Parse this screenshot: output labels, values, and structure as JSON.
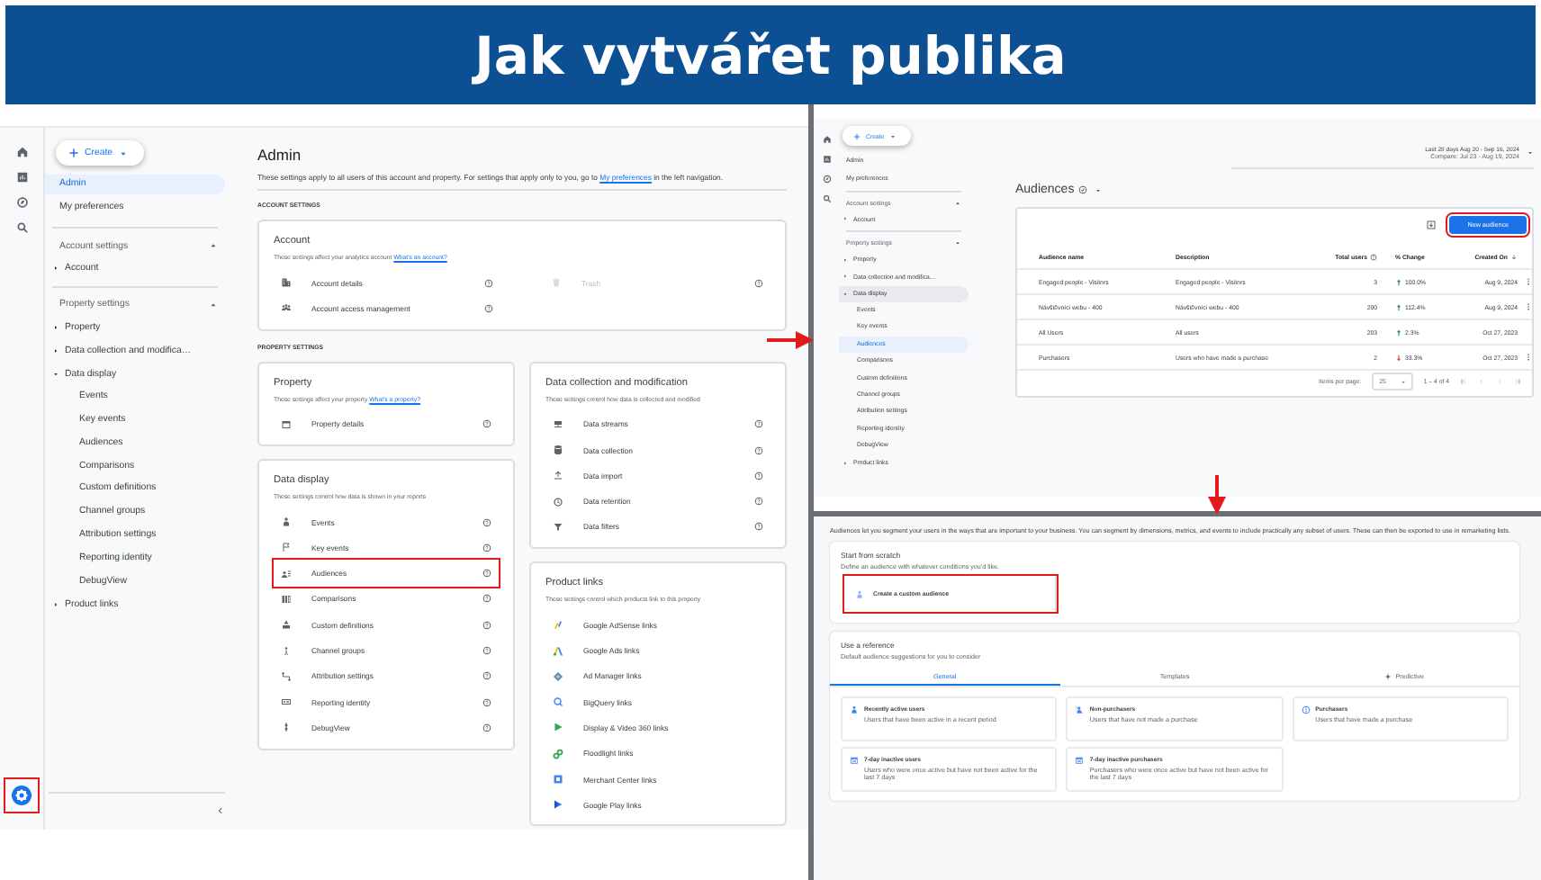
{
  "banner": {
    "title": "Jak vytvářet publika"
  },
  "admin_screen": {
    "settings_highlighted": true,
    "nav": {
      "create": "Create",
      "items": [
        {
          "label": "Admin",
          "selected": true
        },
        {
          "label": "My preferences",
          "selected": false
        }
      ],
      "sections": [
        {
          "title": "Account settings",
          "expanded": true,
          "items": [
            {
              "label": "Account",
              "expanded": false
            }
          ]
        },
        {
          "title": "Property settings",
          "expanded": true,
          "items": [
            {
              "label": "Property",
              "expanded": false
            },
            {
              "label": "Data collection and modifica…",
              "expanded": false
            },
            {
              "label": "Data display",
              "expanded": true,
              "children": [
                {
                  "label": "Events",
                  "selected": false
                },
                {
                  "label": "Key events",
                  "selected": false
                },
                {
                  "label": "Audiences",
                  "selected": false
                },
                {
                  "label": "Comparisons",
                  "selected": false
                },
                {
                  "label": "Custom definitions",
                  "selected": false
                },
                {
                  "label": "Channel groups",
                  "selected": false
                },
                {
                  "label": "Attribution settings",
                  "selected": false
                },
                {
                  "label": "Reporting identity",
                  "selected": false
                },
                {
                  "label": "DebugView",
                  "selected": false
                }
              ]
            },
            {
              "label": "Product links",
              "expanded": false
            }
          ]
        }
      ]
    },
    "title": "Admin",
    "description": {
      "before": "These settings apply to all users of this account and property. For settings that apply only to you, go to ",
      "link": "My preferences",
      "after": " in the left navigation."
    },
    "account_settings": {
      "heading": "ACCOUNT SETTINGS",
      "card": {
        "title": "Account",
        "description": "These settings affect your analytics account",
        "link": "What's an account?",
        "rows": [
          {
            "label": "Account details",
            "disabled": false
          },
          {
            "label": "Trash",
            "disabled": true
          },
          {
            "label": "Account access management",
            "disabled": false
          }
        ]
      }
    },
    "property_settings": {
      "heading": "PROPERTY SETTINGS",
      "columns": [
        [
          {
            "kind": "settings",
            "title": "Property",
            "description": "These settings affect your property",
            "link": "What's a property?",
            "rows": [
              {
                "label": "Property details",
                "highlighted": false
              }
            ]
          },
          {
            "kind": "settings",
            "title": "Data display",
            "description": "These settings control how data is shown in your reports",
            "rows": [
              {
                "label": "Events",
                "highlighted": false
              },
              {
                "label": "Key events",
                "highlighted": false
              },
              {
                "label": "Audiences",
                "highlighted": true
              },
              {
                "label": "Comparisons",
                "highlighted": false
              },
              {
                "label": "Custom definitions",
                "highlighted": false
              },
              {
                "label": "Channel groups",
                "highlighted": false
              },
              {
                "label": "Attribution settings",
                "highlighted": false
              },
              {
                "label": "Reporting identity",
                "highlighted": false
              },
              {
                "label": "DebugView",
                "highlighted": false
              }
            ]
          }
        ],
        [
          {
            "kind": "settings",
            "title": "Data collection and modification",
            "description": "These settings control how data is collected and modified",
            "rows": [
              {
                "label": "Data streams",
                "highlighted": false
              },
              {
                "label": "Data collection",
                "highlighted": false
              },
              {
                "label": "Data import",
                "highlighted": false
              },
              {
                "label": "Data retention",
                "highlighted": false
              },
              {
                "label": "Data filters",
                "highlighted": false
              }
            ]
          },
          {
            "kind": "links",
            "title": "Product links",
            "description": "These settings control which products link to this property",
            "rows": [
              {
                "label": "Google AdSense links",
                "highlighted": false
              },
              {
                "label": "Google Ads links",
                "highlighted": false
              },
              {
                "label": "Ad Manager links",
                "highlighted": false
              },
              {
                "label": "BigQuery links",
                "highlighted": false
              },
              {
                "label": "Display & Video 360 links",
                "highlighted": false
              },
              {
                "label": "Floodlight links",
                "highlighted": false
              },
              {
                "label": "Merchant Center links",
                "highlighted": false
              },
              {
                "label": "Google Play links",
                "highlighted": false
              }
            ]
          }
        ]
      ]
    }
  },
  "audiences_screen": {
    "nav": {
      "create": "Create",
      "items": [
        {
          "label": "Admin",
          "selected": false
        },
        {
          "label": "My preferences",
          "selected": false
        }
      ],
      "sections": [
        {
          "title": "Account settings",
          "expanded": true,
          "items": [
            {
              "label": "Account",
              "expanded": false
            }
          ]
        },
        {
          "title": "Property settings",
          "expanded": true,
          "items": [
            {
              "label": "Property",
              "expanded": false
            },
            {
              "label": "Data collection and modifica…",
              "expanded": false
            },
            {
              "label": "Data display",
              "expanded": true,
              "children": [
                {
                  "label": "Events",
                  "selected": false
                },
                {
                  "label": "Key events",
                  "selected": false
                },
                {
                  "label": "Audiences",
                  "selected": true
                },
                {
                  "label": "Comparisons",
                  "selected": false
                },
                {
                  "label": "Custom definitions",
                  "selected": false
                },
                {
                  "label": "Channel groups",
                  "selected": false
                },
                {
                  "label": "Attribution settings",
                  "selected": false
                },
                {
                  "label": "Reporting identity",
                  "selected": false
                },
                {
                  "label": "DebugView",
                  "selected": false
                }
              ]
            },
            {
              "label": "Product links",
              "expanded": false
            }
          ]
        }
      ]
    },
    "date_range": "Last 28 days  Aug 20 - Sep 16, 2024",
    "compare": "Compare: Jul 23 - Aug 19, 2024",
    "title": "Audiences",
    "new_button": {
      "label": "New audience",
      "highlighted": true
    },
    "table": {
      "columns": [
        "Audience name",
        "Description",
        "Total users",
        "% Change",
        "Created On"
      ],
      "rows": [
        {
          "cells": [
            "Engaged people - Visitors",
            "Engaged people - Visitors",
            "3",
            "100.0%",
            "Aug 9, 2024"
          ],
          "rising": true,
          "menu": true
        },
        {
          "cells": [
            "Návštěvníci webu - 400",
            "Návštěvníci webu - 400",
            "200",
            "112.4%",
            "Aug 9, 2024"
          ],
          "rising": true,
          "menu": true
        },
        {
          "cells": [
            "All Users",
            "All users",
            "203",
            "2.3%",
            "Oct 27, 2023"
          ],
          "rising": true,
          "menu": false
        },
        {
          "cells": [
            "Purchasers",
            "Users who have made a purchase",
            "2",
            "33.3%",
            "Oct 27, 2023"
          ],
          "rising": false,
          "menu": true
        }
      ]
    },
    "footer": {
      "items_label": "Items per page:",
      "page_size": "25",
      "range": "1 – 4 of 4"
    }
  },
  "create_screen": {
    "description": "Audiences let you segment your users in the ways that are important to your business. You can segment by dimensions, metrics, and events to include practically any subset of users. These can then be exported to use in remarketing lists.",
    "scratch": {
      "title": "Start from scratch",
      "description": "Define an audience with whatever conditions you'd like.",
      "button": {
        "label": "Create a custom audience",
        "highlighted": true
      }
    },
    "reference": {
      "title": "Use a reference",
      "description": "Default audience suggestions for you to consider",
      "tabs": [
        {
          "label": "General",
          "selected": true
        },
        {
          "label": "Templates",
          "selected": false
        },
        {
          "label": "Predictive",
          "selected": false
        }
      ],
      "suggestions": [
        {
          "title": "Recently active users",
          "description": "Users that have been active in a recent period"
        },
        {
          "title": "Non-purchasers",
          "description": "Users that have not made a purchase"
        },
        {
          "title": "Purchasers",
          "description": "Users that have made a purchase"
        },
        {
          "title": "7-day inactive users",
          "description": "Users who were once active but have not been active for the last 7 days"
        },
        {
          "title": "7-day inactive purchasers",
          "description": "Purchasers who were once active but have not been active for the last 7 days"
        }
      ]
    }
  }
}
